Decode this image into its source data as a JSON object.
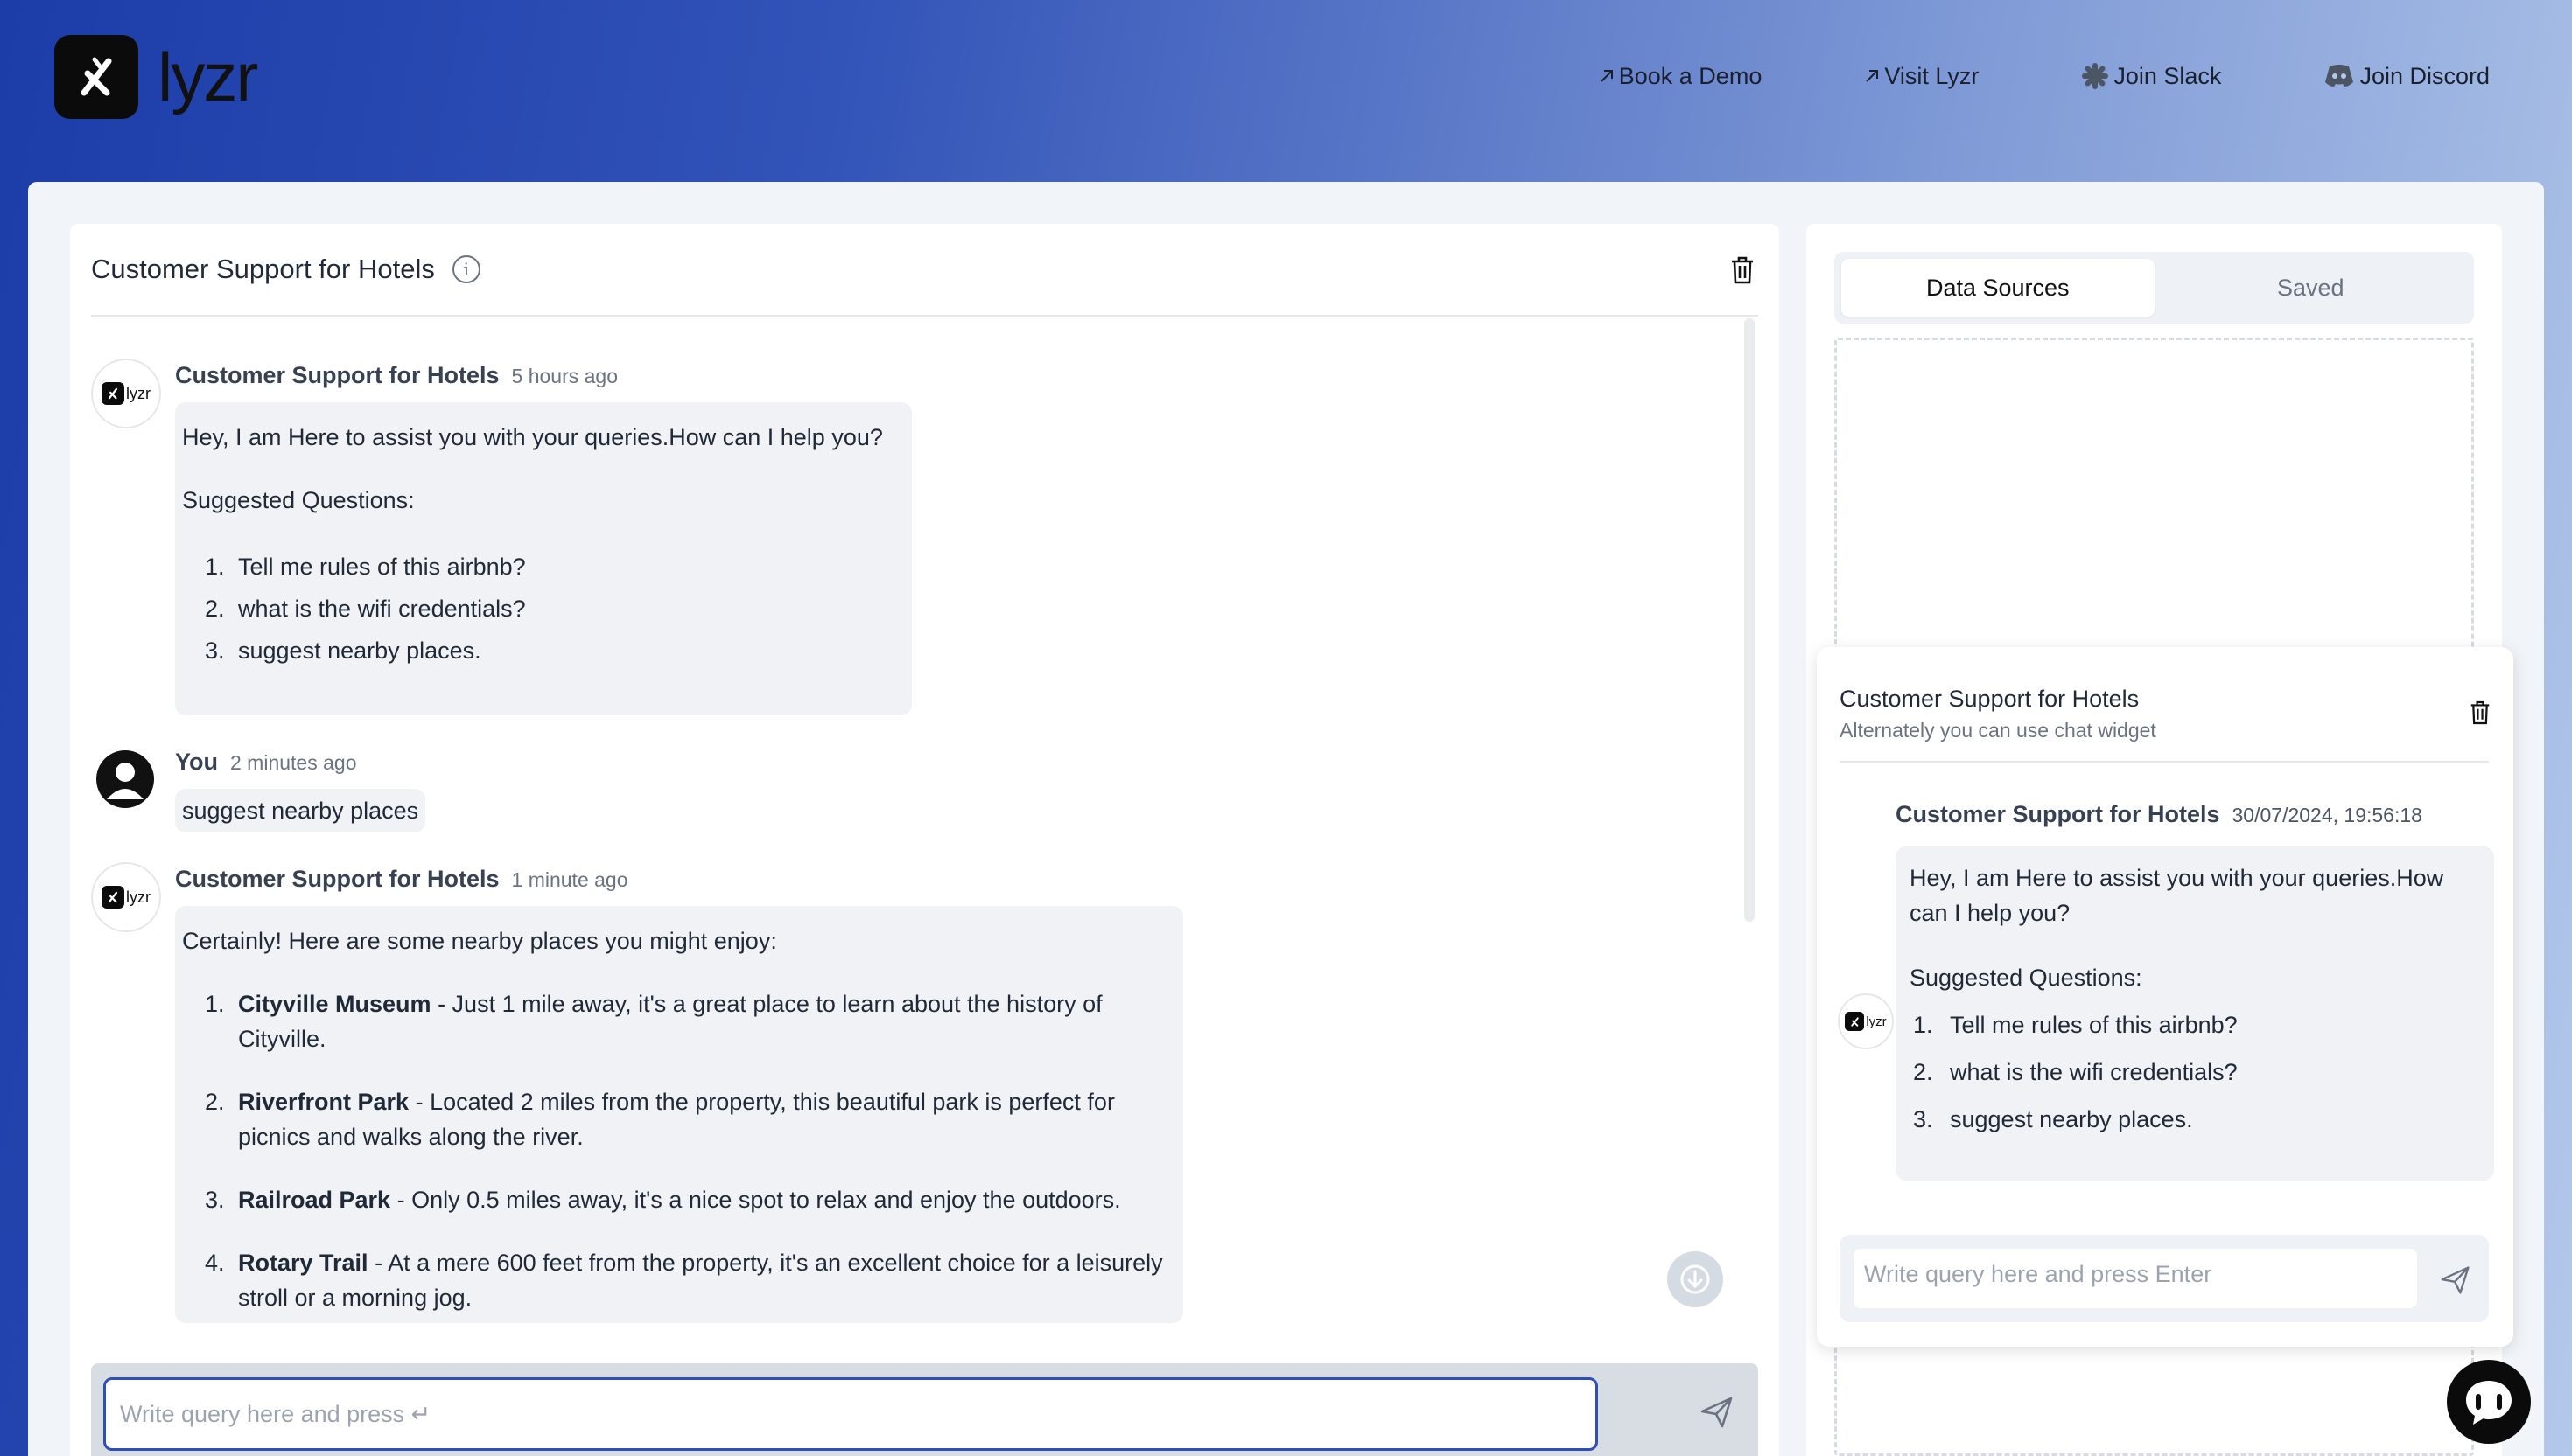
{
  "nav": {
    "brand": "lyzr",
    "links": [
      {
        "label": "Book a Demo",
        "icon": "arrow-up-right-icon"
      },
      {
        "label": "Visit Lyzr",
        "icon": "arrow-up-right-icon"
      },
      {
        "label": "Join Slack",
        "icon": "slack-icon"
      },
      {
        "label": "Join Discord",
        "icon": "discord-icon"
      }
    ]
  },
  "chat": {
    "title": "Customer Support for Hotels",
    "input_placeholder": "Write query here and press ↵",
    "messages": [
      {
        "sender": "Customer Support for Hotels",
        "time": "5 hours ago",
        "intro": "Hey, I am Here to assist you with your queries.How can I help you?",
        "suggested_label": "Suggested Questions:",
        "suggestions": [
          "Tell me rules of this airbnb?",
          "what is the wifi credentials?",
          "suggest nearby places."
        ]
      },
      {
        "sender": "You",
        "time": "2 minutes ago",
        "text": "suggest nearby places"
      },
      {
        "sender": "Customer Support for Hotels",
        "time": "1 minute ago",
        "intro": "Certainly! Here are some nearby places you might enjoy:",
        "places": [
          {
            "name": "Cityville Museum",
            "desc": " - Just 1 mile away, it's a great place to learn about the history of Cityville."
          },
          {
            "name": "Riverfront Park",
            "desc": " - Located 2 miles from the property, this beautiful park is perfect for picnics and walks along the river."
          },
          {
            "name": "Railroad Park",
            "desc": " - Only 0.5 miles away, it's a nice spot to relax and enjoy the outdoors."
          },
          {
            "name": "Rotary Trail",
            "desc": " - At a mere 600 feet from the property, it's an excellent choice for a leisurely stroll or a morning jog."
          }
        ]
      }
    ]
  },
  "sidebar": {
    "tabs": [
      "Data Sources",
      "Saved"
    ],
    "active_tab": "Data Sources"
  },
  "widget": {
    "title": "Customer Support for Hotels",
    "subtitle": "Alternately you can use chat widget",
    "sender": "Customer Support for Hotels",
    "time": "30/07/2024, 19:56:18",
    "intro": "Hey, I am Here to assist you with your queries.How can I help you?",
    "suggested_label": "Suggested Questions:",
    "suggestions": [
      "Tell me rules of this airbnb?",
      "what is the wifi credentials?",
      "suggest nearby places."
    ],
    "input_placeholder": "Write query here and press Enter"
  },
  "colors": {
    "accent": "#2f4fb7",
    "bubble": "#f0f2f6",
    "header_gradient_start": "#1c3ca8",
    "header_gradient_end": "#b3c8ea"
  }
}
